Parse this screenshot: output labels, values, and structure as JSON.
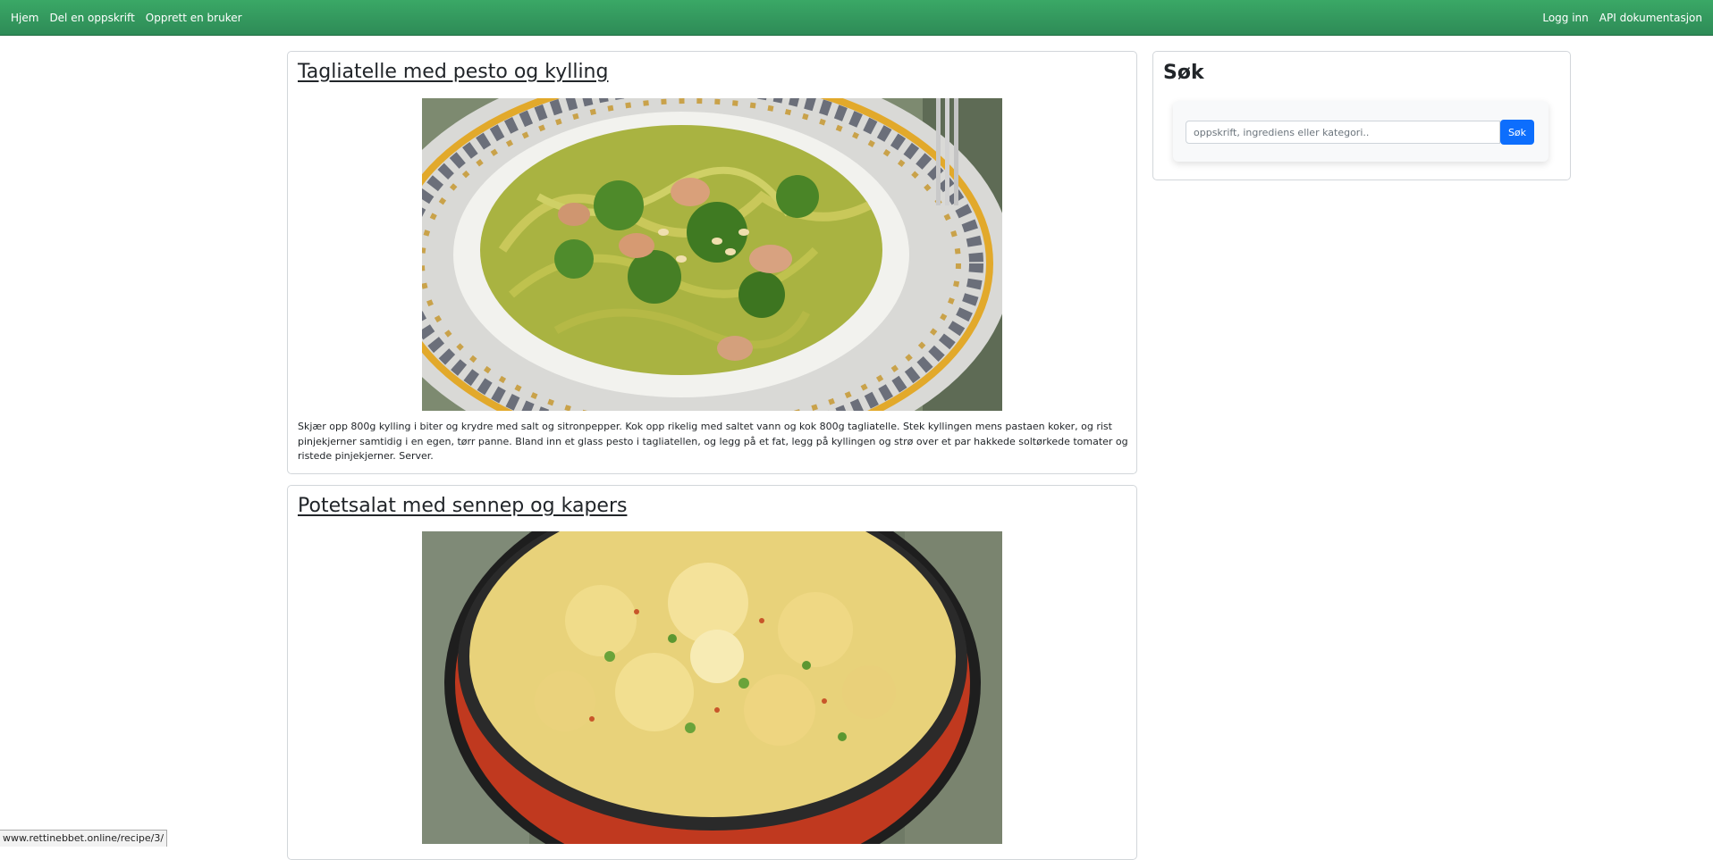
{
  "nav": {
    "left": [
      "Hjem",
      "Del en oppskrift",
      "Opprett en bruker"
    ],
    "right": [
      "Logg inn",
      "API dokumentasjon"
    ],
    "background": "#2e8b57"
  },
  "recipes": [
    {
      "title": "Tagliatelle med pesto og kylling",
      "image": "pasta-pesto-chicken-photo",
      "description": "Skjær opp 800g kylling i biter og krydre med salt og sitronpepper. Kok opp rikelig med saltet vann og kok 800g tagliatelle. Stek kyllingen mens pastaen koker, og rist pinjekjerner samtidig i en egen, tørr panne. Bland inn et glass pesto i tagliatellen, og legg på et fat, legg på kyllingen og strø over et par hakkede soltørkede tomater og ristede pinjekjerner. Server."
    },
    {
      "title": "Potetsalat med sennep og kapers",
      "image": "potato-salad-photo"
    }
  ],
  "search": {
    "title": "Søk",
    "placeholder": "oppskrift, ingrediens eller kategori..",
    "button": "Søk",
    "button_color": "#0d6efd"
  },
  "status_bar": {
    "url": "www.rettinebbet.online/recipe/3/"
  }
}
